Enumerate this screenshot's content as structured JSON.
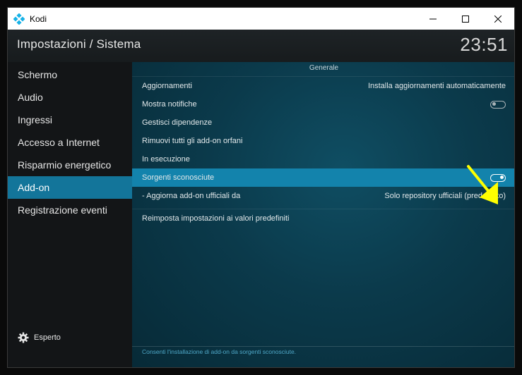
{
  "window": {
    "title": "Kodi",
    "controls": {
      "minimize": "minimize-icon",
      "maximize": "maximize-icon",
      "close": "close-icon"
    }
  },
  "header": {
    "title": "Impostazioni / Sistema",
    "clock": "23:51"
  },
  "sidebar": {
    "items": [
      {
        "label": "Schermo"
      },
      {
        "label": "Audio"
      },
      {
        "label": "Ingressi"
      },
      {
        "label": "Accesso a Internet"
      },
      {
        "label": "Risparmio energetico"
      },
      {
        "label": "Add-on"
      },
      {
        "label": "Registrazione eventi"
      }
    ],
    "active_index": 5,
    "level_label": "Esperto"
  },
  "content": {
    "section": "Generale",
    "rows": [
      {
        "label": "Aggiornamenti",
        "value": "Installa aggiornamenti automaticamente"
      },
      {
        "label": "Mostra notifiche",
        "toggle": "off"
      },
      {
        "label": "Gestisci dipendenze"
      },
      {
        "label": "Rimuovi tutti gli add-on orfani"
      },
      {
        "label": "In esecuzione"
      },
      {
        "label": "Sorgenti sconosciute",
        "toggle": "on"
      },
      {
        "label": "- Aggiorna add-on ufficiali da",
        "value": "Solo repository ufficiali (predefinito)"
      },
      {
        "label": "Reimposta impostazioni ai valori predefiniti"
      }
    ],
    "selected_index": 5,
    "help_text": "Consenti l'installazione di add-on da sorgenti sconosciute."
  },
  "colors": {
    "accent": "#13759a",
    "selected_row": "#1383ac",
    "annotation_arrow": "#ffff00"
  }
}
